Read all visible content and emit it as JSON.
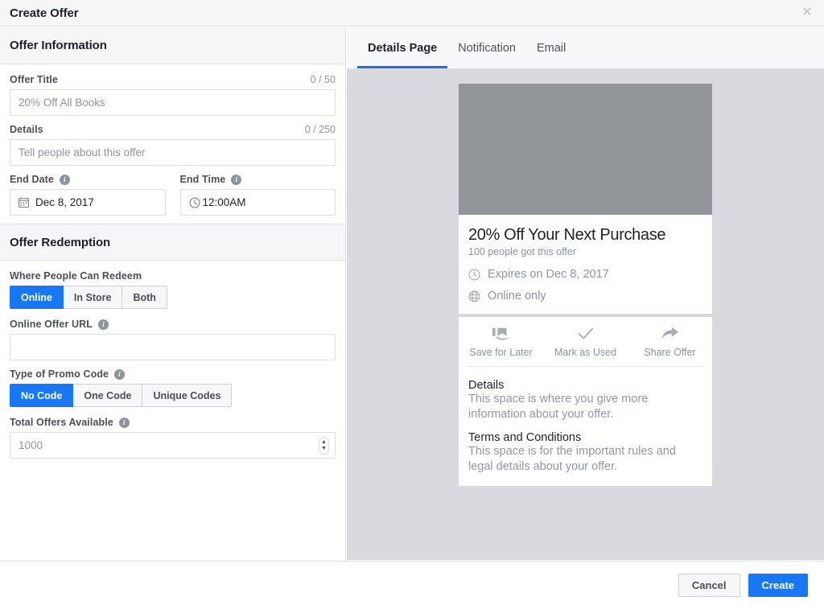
{
  "dialog": {
    "title": "Create Offer",
    "close_icon": "close-icon"
  },
  "form": {
    "sections": [
      {
        "title": "Offer Information"
      },
      {
        "title": "Offer Redemption"
      }
    ],
    "offer_title": {
      "label": "Offer Title",
      "counter": "0 / 50",
      "placeholder": "20% Off All Books",
      "value": ""
    },
    "details": {
      "label": "Details",
      "counter": "0 / 250",
      "placeholder": "Tell people about this offer",
      "value": ""
    },
    "end_date": {
      "label": "End Date",
      "value": "Dec 8, 2017",
      "icon": "calendar-icon",
      "info_icon": "info-icon"
    },
    "end_time": {
      "label": "End Time",
      "value": "12:00AM",
      "icon": "clock-icon",
      "info_icon": "info-icon"
    },
    "where_redeem": {
      "label": "Where People Can Redeem",
      "options": [
        "Online",
        "In Store",
        "Both"
      ],
      "selected": "Online"
    },
    "online_offer_url": {
      "label": "Online Offer URL",
      "placeholder": "",
      "value": "",
      "info_icon": "info-icon"
    },
    "promo_code_type": {
      "label": "Type of Promo Code",
      "options": [
        "No Code",
        "One Code",
        "Unique Codes"
      ],
      "selected": "No Code",
      "info_icon": "info-icon"
    },
    "total_offers": {
      "label": "Total Offers Available",
      "placeholder": "1000",
      "value": "",
      "info_icon": "info-icon",
      "stepper_up": "▲",
      "stepper_down": "▼"
    }
  },
  "preview": {
    "tabs": [
      {
        "label": "Details Page",
        "active": true
      },
      {
        "label": "Notification",
        "active": false
      },
      {
        "label": "Email",
        "active": false
      }
    ],
    "photo_placeholder": "offer-photo-placeholder",
    "card": {
      "title": "20% Off Your Next Purchase",
      "subtitle": "100 people got this offer",
      "expires": "Expires on Dec 8, 2017",
      "expires_icon": "clock-icon",
      "redeem": "Online only",
      "redeem_icon": "globe-icon"
    },
    "actions": [
      {
        "label": "Save for Later",
        "icon": "save-for-later-icon"
      },
      {
        "label": "Mark as Used",
        "icon": "check-icon"
      },
      {
        "label": "Share Offer",
        "icon": "share-arrow-icon"
      }
    ],
    "details_heading": "Details",
    "details_body": "This space is where you give more information about your offer.",
    "terms_heading": "Terms and Conditions",
    "terms_body": "This space is for the important rules and legal details about your offer."
  },
  "footer": {
    "cancel_label": "Cancel",
    "create_label": "Create"
  },
  "colors": {
    "accent_blue": "#1877f2",
    "tab_underline": "#4267b2",
    "panel_gray": "#d8dadf",
    "photo_gray": "#929599"
  }
}
